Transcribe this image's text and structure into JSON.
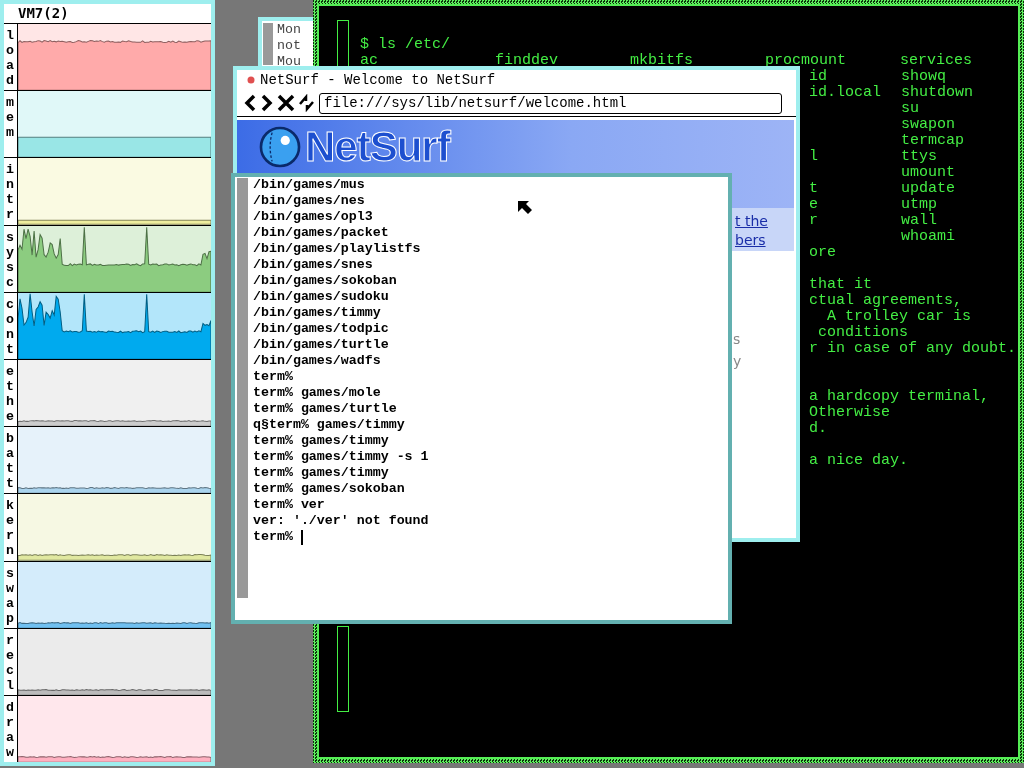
{
  "stats_window": {
    "title": "VM7(2)",
    "graphs": [
      {
        "label": "load",
        "kind": "high",
        "color": "#ffaaaa"
      },
      {
        "label": "mem",
        "kind": "mid",
        "color": "#99e6e6"
      },
      {
        "label": "intr",
        "kind": "low",
        "color": "#eeee9e"
      },
      {
        "label": "sysc",
        "kind": "spiky",
        "color": "#8ccc80"
      },
      {
        "label": "cont",
        "kind": "spiky",
        "color": "#00aaee"
      },
      {
        "label": "ethe",
        "kind": "zero",
        "color": "#cccccc"
      },
      {
        "label": "batt",
        "kind": "zero",
        "color": "#aad4ee"
      },
      {
        "label": "kern",
        "kind": "zero",
        "color": "#e0e8a0"
      },
      {
        "label": "swap",
        "kind": "zero",
        "color": "#70c0f0"
      },
      {
        "label": "recl",
        "kind": "zero",
        "color": "#bbbbbb"
      },
      {
        "label": "draw",
        "kind": "zero",
        "color": "#ffb0c0"
      }
    ]
  },
  "back_window": {
    "lines": [
      "Mon",
      "not",
      "Mou"
    ]
  },
  "ls_terminal": {
    "command": "$ ls /etc/",
    "first_row": [
      "ac",
      "finddev",
      "mkbitfs",
      "procmount",
      "services"
    ],
    "rows": [
      {
        "column_4": "id",
        "column_5": "showq"
      },
      {
        "column_4": "id.local",
        "column_5": "shutdown"
      },
      {
        "column_5": "su"
      },
      {
        "column_5": "swapon"
      },
      {
        "column_5": "termcap"
      },
      {
        "column_4": "l",
        "column_5": "ttys"
      },
      {
        "column_5": "umount"
      },
      {
        "column_4": "t",
        "column_5": "update"
      },
      {
        "column_4": "e",
        "column_5": "utmp"
      },
      {
        "column_4": "r",
        "column_5": "wall"
      },
      {
        "column_5": "whoami"
      },
      {
        "column_4": "ore"
      }
    ],
    "paragraphs": [
      [
        "that it",
        "ctual agreements,",
        "  A trolley car is",
        " conditions",
        "r in case of any doubt."
      ],
      [
        "a hardcopy terminal,",
        "Otherwise",
        "d."
      ],
      [
        "a nice day."
      ]
    ]
  },
  "browser": {
    "title": "NetSurf - Welcome to NetSurf",
    "url": "file:///sys/lib/netsurf/welcome.html",
    "logo_text": "NetSurf",
    "links": [
      "t the",
      "bers"
    ],
    "fragments": [
      "s",
      "y"
    ]
  },
  "rc_terminal": {
    "lines": [
      "/bin/games/mus",
      "/bin/games/nes",
      "/bin/games/opl3",
      "/bin/games/packet",
      "/bin/games/playlistfs",
      "/bin/games/snes",
      "/bin/games/sokoban",
      "/bin/games/sudoku",
      "/bin/games/timmy",
      "/bin/games/todpic",
      "/bin/games/turtle",
      "/bin/games/wadfs",
      "term%",
      "term% games/mole",
      "term% games/turtle",
      "q§term% games/timmy",
      "term% games/timmy",
      "term% games/timmy -s 1",
      "term% games/timmy",
      "term% games/sokoban",
      "term% ver",
      "ver: './ver' not found",
      "term%"
    ]
  }
}
